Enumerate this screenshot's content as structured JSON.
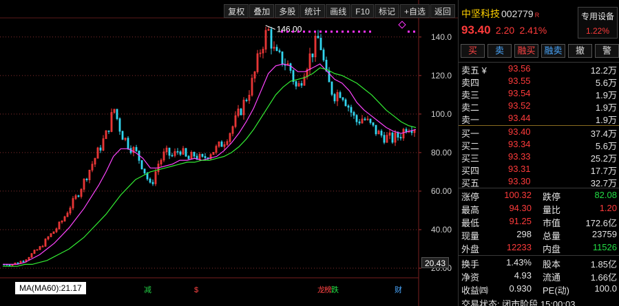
{
  "toolbar": [
    "复权",
    "叠加",
    "多股",
    "统计",
    "画线",
    "F10",
    "标记",
    "+自选",
    "返回"
  ],
  "chart": {
    "y_ticks": [
      "140.0",
      "120.0",
      "100.0",
      "80.00",
      "60.00",
      "40.00",
      "20.00"
    ],
    "high_annotation": "146.00",
    "current_value_tag": "20.43",
    "ma_label": "MA(MA60):21.17",
    "event_marks": [
      {
        "text": "减",
        "color": "#22cc44"
      },
      {
        "text": "$",
        "color": "#ff4444"
      },
      {
        "text": "龙",
        "color": "#ff4444"
      },
      {
        "text": "榜",
        "color": "#ff4444"
      },
      {
        "text": "跌",
        "color": "#22dd44"
      },
      {
        "text": "财",
        "color": "#4aa8ff"
      }
    ],
    "colors": {
      "up": "#ff3b3b",
      "down": "#33d6f0",
      "ma_short": "#ff44ff",
      "ma_long": "#33ee33",
      "grid": "#8a2f2f"
    }
  },
  "chart_data": {
    "type": "line",
    "ylim": [
      20,
      146
    ],
    "high": 146.0,
    "series": [
      {
        "name": "close",
        "values": [
          22,
          22,
          23,
          25,
          28,
          31,
          36,
          40,
          45,
          52,
          58,
          66,
          74,
          82,
          90,
          103,
          90,
          84,
          80,
          72,
          62,
          74,
          80,
          78,
          82,
          76,
          79,
          76,
          80,
          82,
          86,
          92,
          100,
          108,
          118,
          134,
          144,
          130,
          128,
          124,
          112,
          124,
          132,
          140,
          118,
          110,
          112,
          104,
          96,
          98,
          94,
          90,
          88,
          87,
          89,
          94,
          93.4
        ]
      },
      {
        "name": "MA",
        "values": [
          22,
          22,
          22,
          23,
          25,
          27,
          30,
          33,
          37,
          41,
          46,
          51,
          57,
          63,
          70,
          78,
          82,
          82,
          80,
          77,
          72,
          72,
          73,
          74,
          76,
          76,
          77,
          76,
          77,
          78,
          81,
          85,
          90,
          96,
          103,
          112,
          121,
          125,
          126,
          125,
          122,
          122,
          124,
          126,
          122,
          118,
          116,
          112,
          106,
          102,
          99,
          96,
          93,
          91,
          90,
          91,
          92
        ]
      },
      {
        "name": "MA60",
        "values": [
          21,
          21,
          21,
          22,
          22,
          23,
          24,
          26,
          28,
          30,
          33,
          36,
          40,
          44,
          48,
          53,
          58,
          62,
          66,
          68,
          70,
          71,
          72,
          73,
          74,
          75,
          75,
          76,
          76,
          77,
          78,
          80,
          83,
          87,
          92,
          98,
          104,
          110,
          114,
          117,
          118,
          119,
          121,
          124,
          123,
          121,
          120,
          118,
          116,
          113,
          110,
          106,
          102,
          99,
          96,
          94,
          93
        ]
      }
    ]
  },
  "stock": {
    "name": "中坚科技",
    "code": "002779",
    "badge": "R",
    "price": "93.40",
    "change": "2.20",
    "change_pct": "2.41%",
    "special_label": "专用设备",
    "special_value": "1.22%"
  },
  "trade_buttons": [
    {
      "label": "买",
      "color": "#ff4444"
    },
    {
      "label": "卖",
      "color": "#4aa8ff"
    },
    {
      "label": "融买",
      "color": "#ff4444"
    },
    {
      "label": "融卖",
      "color": "#4aa8ff"
    },
    {
      "label": "撤",
      "color": "#dddddd"
    },
    {
      "label": "警",
      "color": "#dddddd"
    }
  ],
  "orderbook": {
    "asks": [
      {
        "label": "卖五 ¥",
        "price": "93.56",
        "volume": "12.2万"
      },
      {
        "label": "卖四",
        "price": "93.55",
        "volume": "5.6万"
      },
      {
        "label": "卖三",
        "price": "93.54",
        "volume": "1.9万"
      },
      {
        "label": "卖二",
        "price": "93.52",
        "volume": "1.9万"
      },
      {
        "label": "卖一",
        "price": "93.44",
        "volume": "1.9万"
      }
    ],
    "bids": [
      {
        "label": "买一",
        "price": "93.40",
        "volume": "37.4万"
      },
      {
        "label": "买二",
        "price": "93.34",
        "volume": "5.6万"
      },
      {
        "label": "买三",
        "price": "93.33",
        "volume": "25.2万"
      },
      {
        "label": "买四",
        "price": "93.31",
        "volume": "17.7万"
      },
      {
        "label": "买五",
        "price": "93.30",
        "volume": "32.7万"
      }
    ]
  },
  "stats": [
    [
      {
        "label": "涨停",
        "value": "100.32",
        "color": "#ff3b3b"
      },
      {
        "label": "跌停",
        "value": "82.08",
        "color": "#22dd44"
      }
    ],
    [
      {
        "label": "最高",
        "value": "94.30",
        "color": "#ff3b3b"
      },
      {
        "label": "量比",
        "value": "1.20",
        "color": "#ff3b3b"
      }
    ],
    [
      {
        "label": "最低",
        "value": "91.25",
        "color": "#ff3b3b"
      },
      {
        "label": "市值",
        "value": "172.6亿",
        "color": "#e4e4e4"
      }
    ],
    [
      {
        "label": "现量",
        "value": "298",
        "color": "#e4e4e4"
      },
      {
        "label": "总量",
        "value": "23759",
        "color": "#e4e4e4"
      }
    ],
    [
      {
        "label": "外盘",
        "value": "12233",
        "color": "#ff3b3b"
      },
      {
        "label": "内盘",
        "value": "11526",
        "color": "#22dd44"
      }
    ]
  ],
  "stats2": [
    [
      {
        "label": "换手",
        "value": "1.43%",
        "color": "#e4e4e4"
      },
      {
        "label": "股本",
        "value": "1.85亿",
        "color": "#e4e4e4"
      }
    ],
    [
      {
        "label": "净资",
        "value": "4.93",
        "color": "#e4e4e4"
      },
      {
        "label": "流通",
        "value": "1.66亿",
        "color": "#e4e4e4"
      }
    ],
    [
      {
        "label": "收益㈣",
        "value": "0.930",
        "color": "#e4e4e4"
      },
      {
        "label": "PE(动)",
        "value": "100.0",
        "color": "#e4e4e4"
      }
    ]
  ],
  "status": "交易状态: 闭市阶段 15:00:03"
}
